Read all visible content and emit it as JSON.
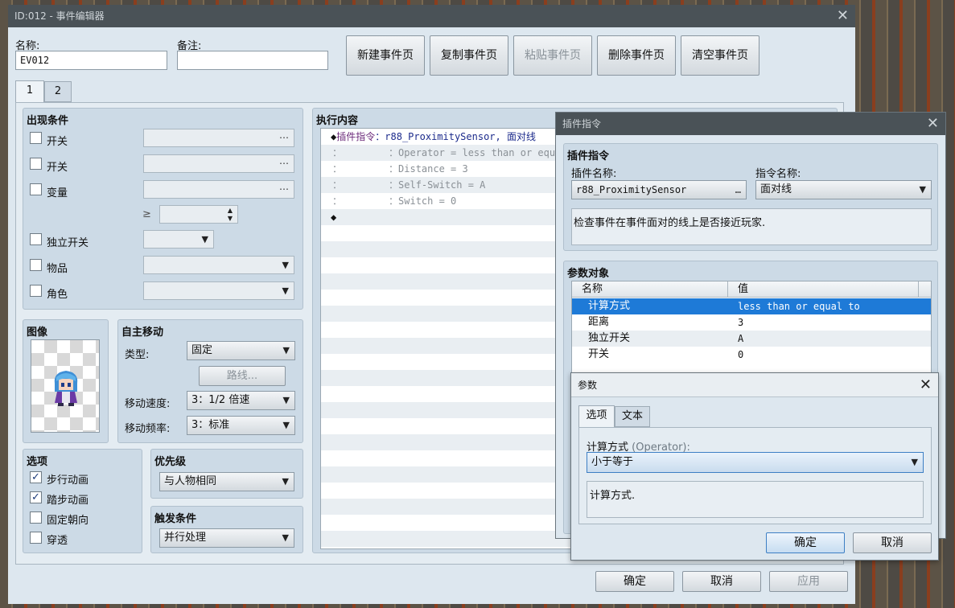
{
  "main_window": {
    "title": "ID:012 - 事件编辑器",
    "name_label": "名称:",
    "name_value": "EV012",
    "note_label": "备注:",
    "note_value": "",
    "buttons": [
      "新建事件页",
      "复制事件页",
      "粘贴事件页",
      "删除事件页",
      "清空事件页"
    ],
    "page_tabs": [
      "1",
      "2"
    ],
    "conditions": {
      "title": "出现条件",
      "switch1": "开关",
      "switch2": "开关",
      "variable": "变量",
      "gte": "≥",
      "self_switch": "独立开关",
      "item": "物品",
      "actor": "角色"
    },
    "image": {
      "title": "图像"
    },
    "autonomous": {
      "title": "自主移动",
      "type_label": "类型:",
      "type_value": "固定",
      "route_button": "路线...",
      "speed_label": "移动速度:",
      "speed_value": "3：1/2 倍速",
      "freq_label": "移动频率:",
      "freq_value": "3：标准"
    },
    "options": {
      "title": "选项",
      "items": [
        {
          "label": "步行动画",
          "checked": true
        },
        {
          "label": "踏步动画",
          "checked": true
        },
        {
          "label": "固定朝向",
          "checked": false
        },
        {
          "label": "穿透",
          "checked": false
        }
      ]
    },
    "priority": {
      "title": "优先级",
      "value": "与人物相同"
    },
    "trigger": {
      "title": "触发条件",
      "value": "并行处理"
    },
    "contents": {
      "title": "执行内容",
      "lines": [
        {
          "prefix": "◆",
          "kw": "插件指令",
          "colon": "：",
          "text": "r88_ProximitySensor, 面对线"
        },
        {
          "prefix": "：",
          "kw": "",
          "colon": "：",
          "text": "Operator = less than or equal"
        },
        {
          "prefix": "：",
          "kw": "",
          "colon": "：",
          "text": "Distance = 3"
        },
        {
          "prefix": "：",
          "kw": "",
          "colon": "：",
          "text": "Self-Switch = A"
        },
        {
          "prefix": "：",
          "kw": "",
          "colon": "：",
          "text": "Switch = 0"
        },
        {
          "prefix": "◆",
          "kw": "",
          "colon": "",
          "text": ""
        }
      ]
    },
    "footer": {
      "ok": "确定",
      "cancel": "取消",
      "apply": "应用"
    }
  },
  "plugin_window": {
    "title": "插件指令",
    "section": "插件指令",
    "plugin_name_label": "插件名称:",
    "plugin_name_value": "r88_ProximitySensor",
    "command_name_label": "指令名称:",
    "command_name_value": "面对线",
    "description": "检查事件在事件面对的线上是否接近玩家.",
    "args_title": "参数对象",
    "col_name": "名称",
    "col_value": "值",
    "args": [
      {
        "name": "计算方式",
        "value": "less than or equal to",
        "selected": true
      },
      {
        "name": "距离",
        "value": "3",
        "selected": false
      },
      {
        "name": "独立开关",
        "value": "A",
        "selected": false
      },
      {
        "name": "开关",
        "value": "0",
        "selected": false
      }
    ]
  },
  "param_window": {
    "title": "参数",
    "tabs": [
      "选项",
      "文本"
    ],
    "field_label": "计算方式",
    "field_hint": "(Operator):",
    "select_value": "小于等于",
    "description": "计算方式.",
    "ok": "确定",
    "cancel": "取消"
  },
  "colors": {
    "selection": "#1e7ad7",
    "titlebar": "#4a5257",
    "dialog": "#dde7ef"
  }
}
